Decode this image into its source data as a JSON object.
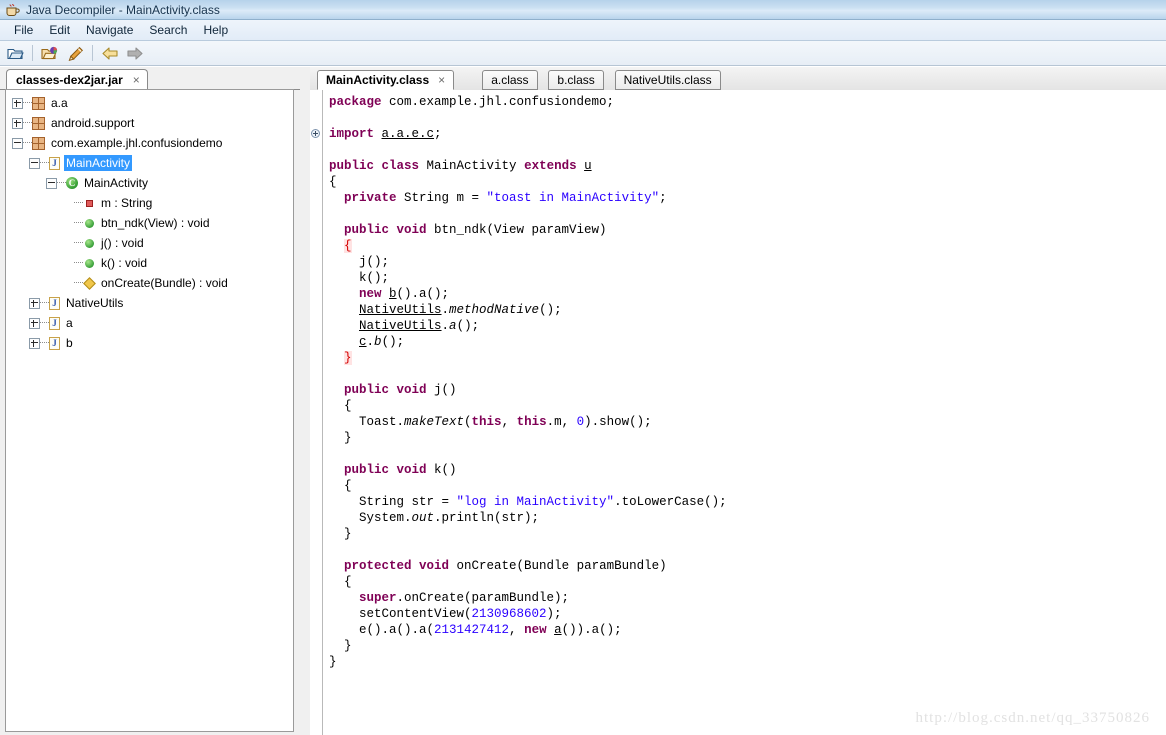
{
  "window": {
    "title": "Java Decompiler - MainActivity.class",
    "app_icon": "java-cup-icon"
  },
  "menubar": {
    "items": [
      {
        "label": "File"
      },
      {
        "label": "Edit"
      },
      {
        "label": "Navigate"
      },
      {
        "label": "Search"
      },
      {
        "label": "Help"
      }
    ]
  },
  "toolbar": {
    "buttons": [
      {
        "name": "open-file-icon",
        "glyph": "open-folder"
      },
      {
        "name": "open-type-icon",
        "glyph": "folder-ball"
      },
      {
        "name": "save-all-icon",
        "glyph": "pen"
      },
      {
        "name": "back-icon",
        "glyph": "arrow-left"
      },
      {
        "name": "forward-icon",
        "glyph": "arrow-right"
      }
    ]
  },
  "jar_tab": {
    "label": "classes-dex2jar.jar",
    "close_glyph": "×"
  },
  "tree": {
    "nodes": [
      {
        "label": "a.a",
        "indent": 0,
        "icon": "package",
        "toggle": "plus",
        "selected": false
      },
      {
        "label": "android.support",
        "indent": 0,
        "icon": "package",
        "toggle": "plus",
        "selected": false
      },
      {
        "label": "com.example.jhl.confusiondemo",
        "indent": 0,
        "icon": "package",
        "toggle": "minus",
        "selected": false
      },
      {
        "label": "MainActivity",
        "indent": 1,
        "icon": "javafile",
        "toggle": "minus",
        "selected": true
      },
      {
        "label": "MainActivity",
        "indent": 2,
        "icon": "class",
        "toggle": "minus",
        "selected": false
      },
      {
        "label": "m : String",
        "indent": 3,
        "icon": "field",
        "toggle": "none",
        "selected": false
      },
      {
        "label": "btn_ndk(View) : void",
        "indent": 3,
        "icon": "method",
        "toggle": "none",
        "selected": false
      },
      {
        "label": "j() : void",
        "indent": 3,
        "icon": "method",
        "toggle": "none",
        "selected": false
      },
      {
        "label": "k() : void",
        "indent": 3,
        "icon": "method",
        "toggle": "none",
        "selected": false
      },
      {
        "label": "onCreate(Bundle) : void",
        "indent": 3,
        "icon": "method-protected",
        "toggle": "none",
        "selected": false
      },
      {
        "label": "NativeUtils",
        "indent": 1,
        "icon": "javafile",
        "toggle": "plus",
        "selected": false
      },
      {
        "label": "a",
        "indent": 1,
        "icon": "javafile",
        "toggle": "plus",
        "selected": false
      },
      {
        "label": "b",
        "indent": 1,
        "icon": "javafile",
        "toggle": "plus",
        "selected": false
      }
    ]
  },
  "editor_tabs": [
    {
      "label": "MainActivity.class",
      "active": true,
      "closable": true
    },
    {
      "label": "a.class",
      "active": false,
      "closable": false
    },
    {
      "label": "b.class",
      "active": false,
      "closable": false
    },
    {
      "label": "NativeUtils.class",
      "active": false,
      "closable": false
    }
  ],
  "code": {
    "language": "java",
    "fold_marker_line": 2,
    "lines": [
      [
        {
          "t": "package ",
          "c": "kw"
        },
        {
          "t": "com.example.jhl.confusiondemo;",
          "c": ""
        }
      ],
      [],
      [
        {
          "t": "import ",
          "c": "kw"
        },
        {
          "t": "a.a.e.c",
          "c": "und"
        },
        {
          "t": ";",
          "c": ""
        }
      ],
      [],
      [
        {
          "t": "public class ",
          "c": "kw"
        },
        {
          "t": "MainActivity ",
          "c": ""
        },
        {
          "t": "extends ",
          "c": "kw"
        },
        {
          "t": "u",
          "c": "und"
        }
      ],
      [
        {
          "t": "{",
          "c": ""
        }
      ],
      [
        {
          "t": "  ",
          "c": ""
        },
        {
          "t": "private ",
          "c": "kw"
        },
        {
          "t": "String m = ",
          "c": ""
        },
        {
          "t": "\"toast in MainActivity\"",
          "c": "str"
        },
        {
          "t": ";",
          "c": ""
        }
      ],
      [],
      [
        {
          "t": "  ",
          "c": ""
        },
        {
          "t": "public void ",
          "c": "kw"
        },
        {
          "t": "btn_ndk(View paramView)",
          "c": ""
        }
      ],
      [
        {
          "t": "  ",
          "c": ""
        },
        {
          "t": "{",
          "c": "brc"
        }
      ],
      [
        {
          "t": "    j();",
          "c": ""
        }
      ],
      [
        {
          "t": "    k();",
          "c": ""
        }
      ],
      [
        {
          "t": "    ",
          "c": ""
        },
        {
          "t": "new ",
          "c": "kw"
        },
        {
          "t": "b",
          "c": "und"
        },
        {
          "t": "().a();",
          "c": ""
        }
      ],
      [
        {
          "t": "    ",
          "c": ""
        },
        {
          "t": "NativeUtils",
          "c": "und"
        },
        {
          "t": ".",
          "c": ""
        },
        {
          "t": "methodNative",
          "c": "it"
        },
        {
          "t": "();",
          "c": ""
        }
      ],
      [
        {
          "t": "    ",
          "c": ""
        },
        {
          "t": "NativeUtils",
          "c": "und"
        },
        {
          "t": ".",
          "c": ""
        },
        {
          "t": "a",
          "c": "it"
        },
        {
          "t": "();",
          "c": ""
        }
      ],
      [
        {
          "t": "    ",
          "c": ""
        },
        {
          "t": "c",
          "c": "und"
        },
        {
          "t": ".",
          "c": ""
        },
        {
          "t": "b",
          "c": "it"
        },
        {
          "t": "();",
          "c": ""
        }
      ],
      [
        {
          "t": "  ",
          "c": ""
        },
        {
          "t": "}",
          "c": "brc"
        }
      ],
      [],
      [
        {
          "t": "  ",
          "c": ""
        },
        {
          "t": "public void ",
          "c": "kw"
        },
        {
          "t": "j()",
          "c": ""
        }
      ],
      [
        {
          "t": "  {",
          "c": ""
        }
      ],
      [
        {
          "t": "    Toast.",
          "c": ""
        },
        {
          "t": "makeText",
          "c": "it"
        },
        {
          "t": "(",
          "c": ""
        },
        {
          "t": "this",
          "c": "kw"
        },
        {
          "t": ", ",
          "c": ""
        },
        {
          "t": "this",
          "c": "kw"
        },
        {
          "t": ".m, ",
          "c": ""
        },
        {
          "t": "0",
          "c": "num"
        },
        {
          "t": ").show();",
          "c": ""
        }
      ],
      [
        {
          "t": "  }",
          "c": ""
        }
      ],
      [],
      [
        {
          "t": "  ",
          "c": ""
        },
        {
          "t": "public void ",
          "c": "kw"
        },
        {
          "t": "k()",
          "c": ""
        }
      ],
      [
        {
          "t": "  {",
          "c": ""
        }
      ],
      [
        {
          "t": "    String str = ",
          "c": ""
        },
        {
          "t": "\"log in MainActivity\"",
          "c": "str"
        },
        {
          "t": ".toLowerCase();",
          "c": ""
        }
      ],
      [
        {
          "t": "    System.",
          "c": ""
        },
        {
          "t": "out",
          "c": "it"
        },
        {
          "t": ".println(str);",
          "c": ""
        }
      ],
      [
        {
          "t": "  }",
          "c": ""
        }
      ],
      [],
      [
        {
          "t": "  ",
          "c": ""
        },
        {
          "t": "protected void ",
          "c": "kw"
        },
        {
          "t": "onCreate(Bundle paramBundle)",
          "c": ""
        }
      ],
      [
        {
          "t": "  {",
          "c": ""
        }
      ],
      [
        {
          "t": "    ",
          "c": ""
        },
        {
          "t": "super",
          "c": "kw"
        },
        {
          "t": ".onCreate(paramBundle);",
          "c": ""
        }
      ],
      [
        {
          "t": "    setContentView(",
          "c": ""
        },
        {
          "t": "2130968602",
          "c": "num"
        },
        {
          "t": ");",
          "c": ""
        }
      ],
      [
        {
          "t": "    e().a().a(",
          "c": ""
        },
        {
          "t": "2131427412",
          "c": "num"
        },
        {
          "t": ", ",
          "c": ""
        },
        {
          "t": "new ",
          "c": "kw"
        },
        {
          "t": "a",
          "c": "und"
        },
        {
          "t": "()).a();",
          "c": ""
        }
      ],
      [
        {
          "t": "  }",
          "c": ""
        }
      ],
      [
        {
          "t": "}",
          "c": ""
        }
      ]
    ]
  },
  "watermark": {
    "text": "http://blog.csdn.net/qq_33750826"
  },
  "colors": {
    "keyword": "#7f0055",
    "string": "#2a00ff",
    "number": "#2a00ff",
    "brace": "#d40000",
    "selection": "#3399ff",
    "titlebar": "#cbe0f2"
  }
}
